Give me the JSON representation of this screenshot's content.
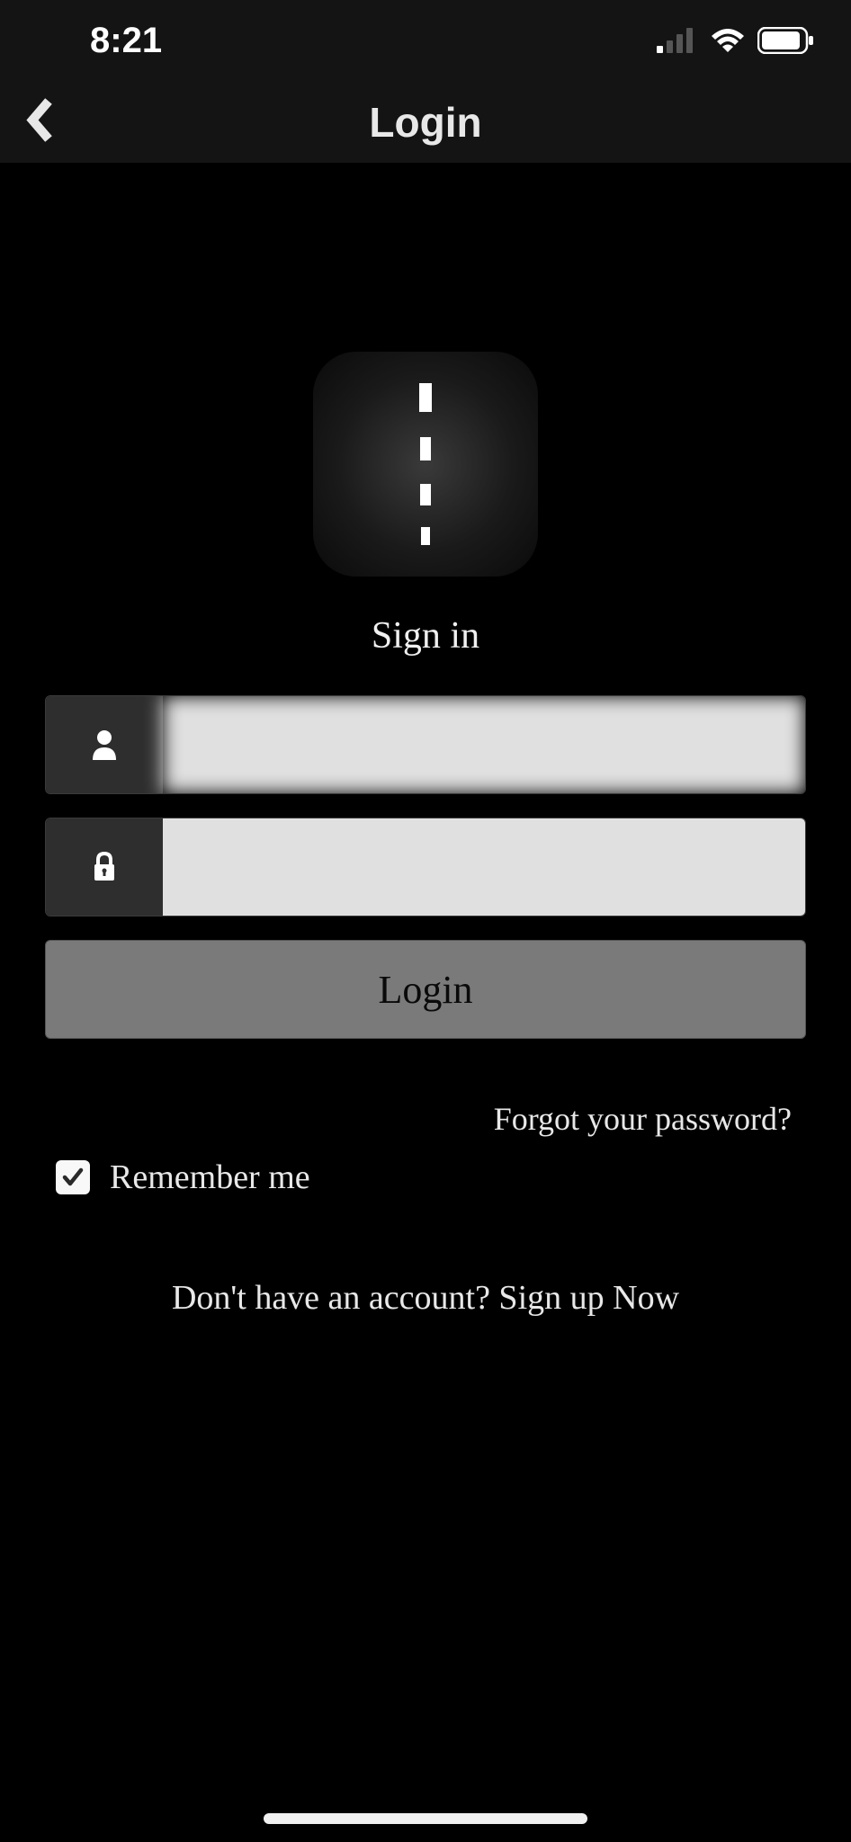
{
  "status_bar": {
    "time": "8:21"
  },
  "header": {
    "title": "Login"
  },
  "signin": {
    "heading": "Sign in",
    "username_value": "",
    "password_value": "",
    "login_button": "Login"
  },
  "options": {
    "forgot_password": "Forgot your password?",
    "remember_me": "Remember me",
    "remember_checked": true
  },
  "signup": {
    "prompt": "Don't have an account? Sign up Now"
  }
}
